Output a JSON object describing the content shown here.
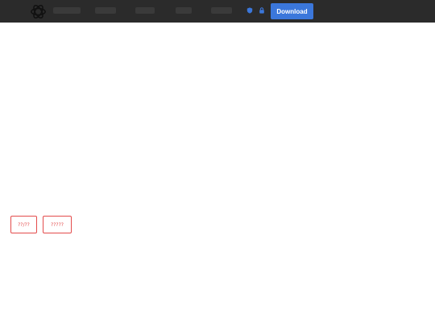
{
  "header": {
    "logo_icon": "openai-logo-icon",
    "download_label": "Download",
    "status_icons": [
      "shield-icon",
      "lock-icon"
    ],
    "accent_color": "#3b77db",
    "bar_color": "#2b2b2b"
  },
  "main": {
    "buttons": [
      {
        "label": "??/??"
      },
      {
        "label": "?????"
      }
    ],
    "button_color": "#e34b4b"
  }
}
